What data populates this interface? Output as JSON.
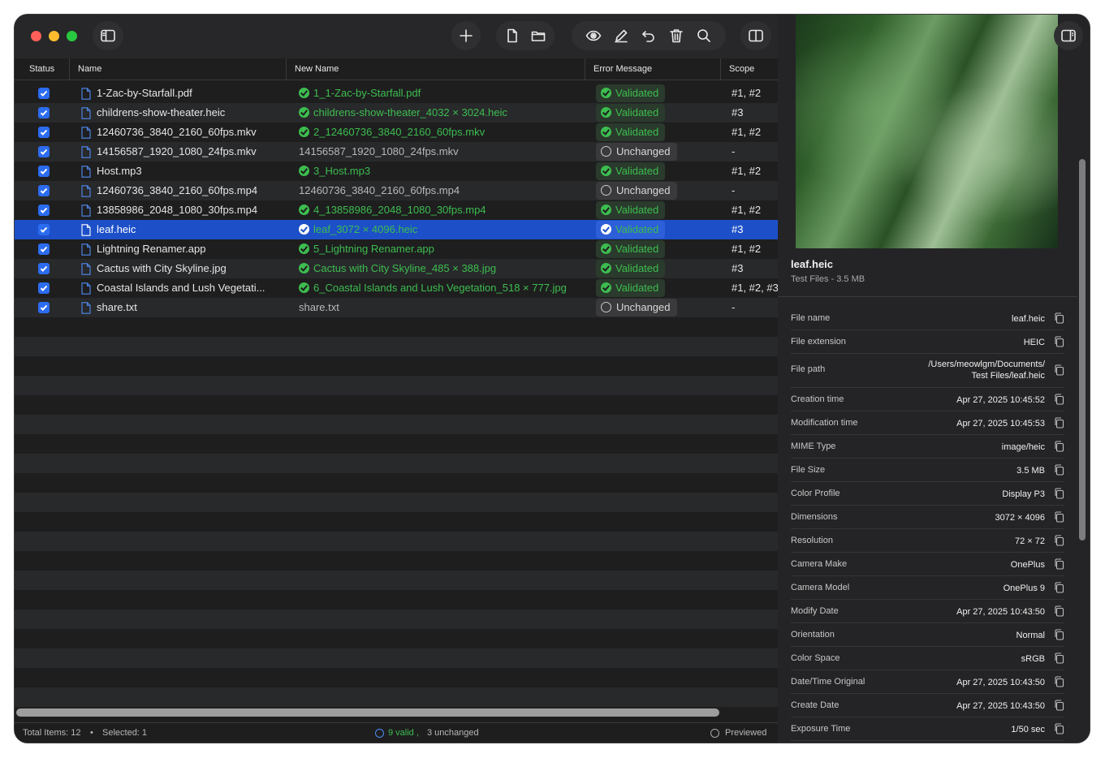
{
  "toolbar": {
    "icons": [
      "sidebar-icon",
      "plus-icon",
      "file-icon",
      "folder-icon",
      "eye-icon",
      "pencil-icon",
      "undo-icon",
      "trash-icon",
      "search-icon",
      "split-view-icon",
      "inspector-icon"
    ]
  },
  "columns": {
    "status": "Status",
    "name": "Name",
    "new_name": "New Name",
    "error": "Error Message",
    "scope": "Scope"
  },
  "rows": [
    {
      "name": "1-Zac-by-Starfall.pdf",
      "new_name": "1_1-Zac-by-Starfall.pdf",
      "state": "valid",
      "error": "Validated",
      "scope": "#1, #2"
    },
    {
      "name": "childrens-show-theater.heic",
      "new_name": "childrens-show-theater_4032 × 3024.heic",
      "state": "valid",
      "error": "Validated",
      "scope": "#3"
    },
    {
      "name": "12460736_3840_2160_60fps.mkv",
      "new_name": "2_12460736_3840_2160_60fps.mkv",
      "state": "valid",
      "error": "Validated",
      "scope": "#1, #2"
    },
    {
      "name": "14156587_1920_1080_24fps.mkv",
      "new_name": "14156587_1920_1080_24fps.mkv",
      "state": "unchanged",
      "error": "Unchanged",
      "scope": "-"
    },
    {
      "name": "Host.mp3",
      "new_name": "3_Host.mp3",
      "state": "valid",
      "error": "Validated",
      "scope": "#1, #2"
    },
    {
      "name": "12460736_3840_2160_60fps.mp4",
      "new_name": "12460736_3840_2160_60fps.mp4",
      "state": "unchanged",
      "error": "Unchanged",
      "scope": "-"
    },
    {
      "name": "13858986_2048_1080_30fps.mp4",
      "new_name": "4_13858986_2048_1080_30fps.mp4",
      "state": "valid",
      "error": "Validated",
      "scope": "#1, #2"
    },
    {
      "name": "leaf.heic",
      "new_name": "leaf_3072 × 4096.heic",
      "state": "valid",
      "error": "Validated",
      "scope": "#3",
      "selected": true
    },
    {
      "name": "Lightning Renamer.app",
      "new_name": "5_Lightning Renamer.app",
      "state": "valid",
      "error": "Validated",
      "scope": "#1, #2"
    },
    {
      "name": "Cactus with City Skyline.jpg",
      "new_name": "Cactus with City Skyline_485 × 388.jpg",
      "state": "valid",
      "error": "Validated",
      "scope": "#3"
    },
    {
      "name": "Coastal Islands and Lush Vegetati...",
      "new_name": "6_Coastal Islands and Lush Vegetation_518 × 777.jpg",
      "state": "valid",
      "error": "Validated",
      "scope": "#1, #2, #3"
    },
    {
      "name": "share.txt",
      "new_name": "share.txt",
      "state": "unchanged",
      "error": "Unchanged",
      "scope": "-"
    }
  ],
  "status_bar": {
    "total": "Total Items: 12",
    "separator": "•",
    "selected": "Selected: 1",
    "valid": "9 valid ,",
    "unchanged": "3 unchanged",
    "previewed": "Previewed"
  },
  "inspector": {
    "title": "leaf.heic",
    "subtitle": "Test Files  -  3.5 MB",
    "fields": [
      {
        "label": "File name",
        "value": "leaf.heic"
      },
      {
        "label": "File extension",
        "value": "HEIC"
      },
      {
        "label": "File path",
        "value": "/Users/meowlgm/Documents/\nTest Files/leaf.heic"
      },
      {
        "label": "Creation time",
        "value": "Apr 27, 2025 10:45:52"
      },
      {
        "label": "Modification time",
        "value": "Apr 27, 2025 10:45:53"
      },
      {
        "label": "MIME Type",
        "value": "image/heic"
      },
      {
        "label": "File Size",
        "value": "3.5 MB"
      },
      {
        "label": "Color Profile",
        "value": "Display P3"
      },
      {
        "label": "Dimensions",
        "value": "3072 × 4096"
      },
      {
        "label": "Resolution",
        "value": "72 × 72"
      },
      {
        "label": "Camera Make",
        "value": "OnePlus"
      },
      {
        "label": "Camera Model",
        "value": "OnePlus 9"
      },
      {
        "label": "Modify Date",
        "value": "Apr 27, 2025 10:43:50"
      },
      {
        "label": "Orientation",
        "value": "Normal"
      },
      {
        "label": "Color Space",
        "value": "sRGB"
      },
      {
        "label": "Date/Time Original",
        "value": "Apr 27, 2025 10:43:50"
      },
      {
        "label": "Create Date",
        "value": "Apr 27, 2025 10:43:50"
      },
      {
        "label": "Exposure Time",
        "value": "1/50 sec"
      }
    ]
  },
  "colors": {
    "accent": "#2c6cf0",
    "selection": "#1d50c8",
    "valid_green": "#3dbd4f",
    "close": "#ff5f57",
    "minimize": "#febc2e",
    "zoom": "#28c840"
  }
}
